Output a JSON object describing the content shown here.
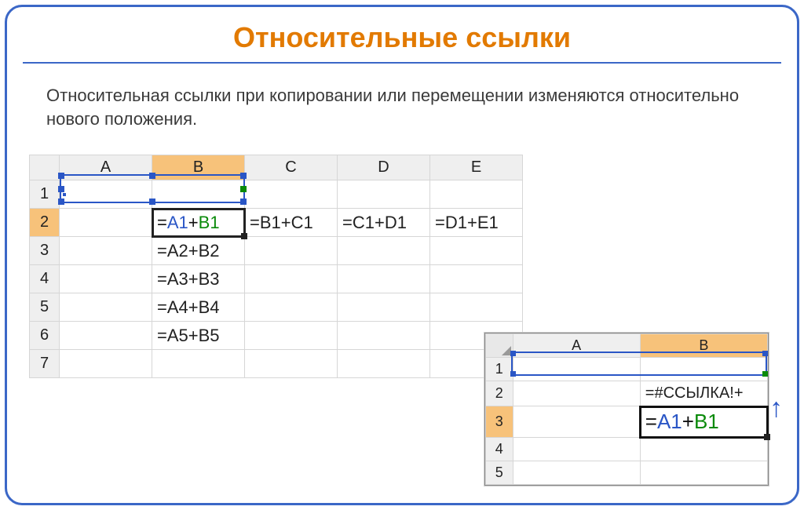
{
  "title": "Относительные ссылки",
  "description": "Относительная ссылки при копировании или перемещении изменяются относительно нового положения.",
  "sheet1": {
    "columns": [
      "A",
      "B",
      "C",
      "D",
      "E"
    ],
    "rows": [
      "1",
      "2",
      "3",
      "4",
      "5",
      "6",
      "7"
    ],
    "active_col_index": 1,
    "active_row_index": 1,
    "b2_formula": {
      "eq": "=",
      "a": "A1",
      "plus": "+",
      "b": "B1"
    },
    "cells": {
      "C2": "=B1+C1",
      "D2": "=C1+D1",
      "E2": "=D1+E1",
      "B3": "=A2+B2",
      "B4": "=A3+B3",
      "B5": "=A4+B4",
      "B6": "=A5+B5"
    }
  },
  "sheet2": {
    "columns": [
      "A",
      "B"
    ],
    "rows": [
      "1",
      "2",
      "3",
      "4",
      "5"
    ],
    "active_col_index": 1,
    "active_row_index": 2,
    "b2_text": "=#ССЫЛКА!+",
    "b3_formula": {
      "eq": "=",
      "a": "A1",
      "plus": "+",
      "b": "B1"
    }
  },
  "arrow": "↑"
}
